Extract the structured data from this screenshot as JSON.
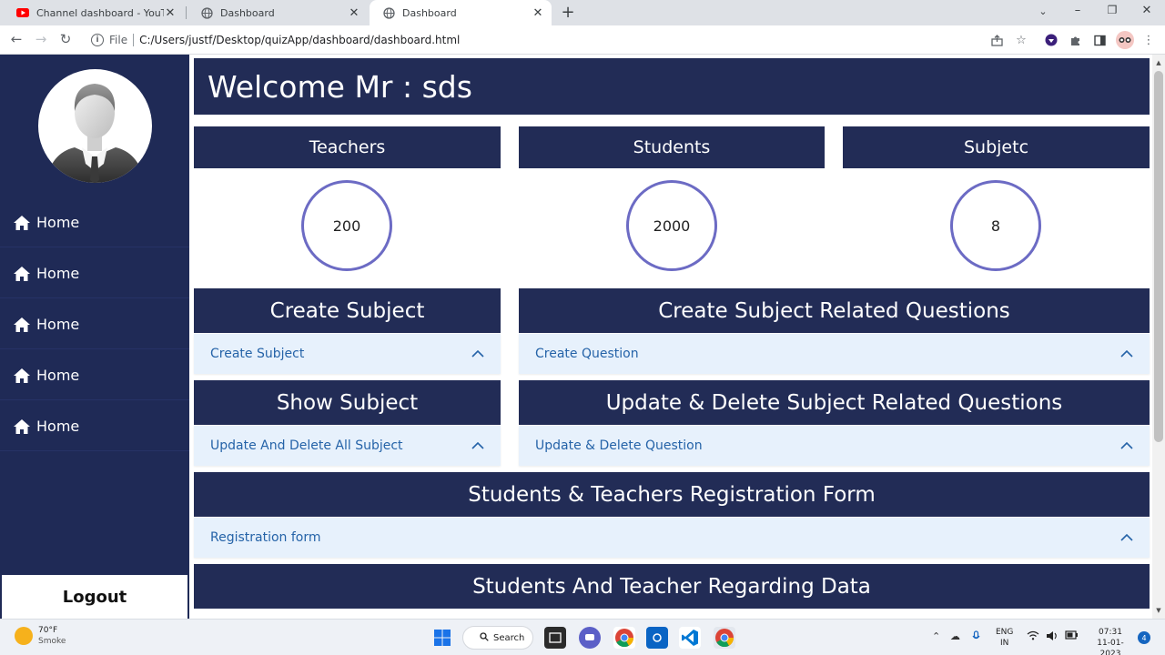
{
  "browser": {
    "tabs": [
      {
        "title": "Channel dashboard - YouTube Studio",
        "icon": "youtube-icon"
      },
      {
        "title": "Dashboard",
        "icon": "globe-icon"
      },
      {
        "title": "Dashboard",
        "icon": "globe-icon",
        "active": true
      }
    ],
    "address": {
      "scheme": "File",
      "url": "C:/Users/justf/Desktop/quizApp/dashboard/dashboard.html"
    }
  },
  "sidebar": {
    "items": [
      {
        "label": "Home",
        "icon": "home-icon"
      },
      {
        "label": "Home",
        "icon": "home-icon"
      },
      {
        "label": "Home",
        "icon": "home-icon"
      },
      {
        "label": "Home",
        "icon": "home-icon"
      },
      {
        "label": "Home",
        "icon": "home-icon"
      }
    ],
    "logout": "Logout"
  },
  "header": {
    "welcome": "Welcome Mr : sds"
  },
  "stats": [
    {
      "label": "Teachers",
      "value": "200"
    },
    {
      "label": "Students",
      "value": "2000"
    },
    {
      "label": "Subjetc",
      "value": "8"
    }
  ],
  "sections": {
    "create_subject": {
      "title": "Create Subject",
      "link": "Create Subject"
    },
    "create_questions": {
      "title": "Create Subject Related Questions",
      "link": "Create Question"
    },
    "show_subject": {
      "title": "Show Subject",
      "link": "Update And Delete All Subject"
    },
    "update_questions": {
      "title": "Update & Delete Subject Related Questions",
      "link": "Update & Delete Question"
    },
    "registration": {
      "title": "Students & Teachers Registration Form",
      "link": "Registration form"
    },
    "regarding_data": {
      "title": "Students And Teacher Regarding Data"
    }
  },
  "taskbar": {
    "weather_temp": "70°F",
    "weather_desc": "Smoke",
    "search": "Search",
    "lang_1": "ENG",
    "lang_2": "IN",
    "time": "07:31",
    "date": "11-01-2023",
    "notifications": "4"
  },
  "colors": {
    "navy": "#222c56",
    "sidebar": "#1f2a56",
    "circle": "#6c6bc4",
    "accordion": "#e7f1fc",
    "link": "#2563a8"
  }
}
